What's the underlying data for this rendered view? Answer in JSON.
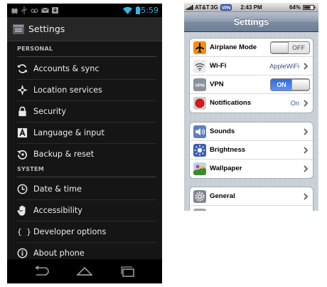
{
  "android": {
    "status_bar": {
      "clock": "05:59",
      "icons": [
        "usb-debug-icon",
        "usb-icon",
        "voicemail-icon",
        "email-icon",
        "download-icon",
        "wifi-icon",
        "battery-icon"
      ]
    },
    "action_bar": {
      "title": "Settings",
      "icon": "settings-app-icon"
    },
    "sections": [
      {
        "header": "PERSONAL",
        "items": [
          {
            "label": "Accounts & sync",
            "icon": "sync-icon"
          },
          {
            "label": "Location services",
            "icon": "location-icon"
          },
          {
            "label": "Security",
            "icon": "lock-icon"
          },
          {
            "label": "Language & input",
            "icon": "keyboard-a-icon"
          },
          {
            "label": "Backup & reset",
            "icon": "backup-icon"
          }
        ]
      },
      {
        "header": "SYSTEM",
        "items": [
          {
            "label": "Date & time",
            "icon": "clock-icon"
          },
          {
            "label": "Accessibility",
            "icon": "hand-icon"
          },
          {
            "label": "Developer options",
            "icon": "braces-icon",
            "glyph": "{ }"
          },
          {
            "label": "About phone",
            "icon": "info-icon"
          }
        ]
      }
    ],
    "nav_bar": [
      "back-icon",
      "home-icon",
      "recent-apps-icon"
    ],
    "colors": {
      "background": "#151515",
      "accent": "#33b5e5"
    }
  },
  "iphone": {
    "status_bar": {
      "carrier": "AT&T",
      "network": "3G",
      "time": "2:43 PM",
      "battery": "64%"
    },
    "nav_bar": {
      "title": "Settings"
    },
    "groups": [
      [
        {
          "label": "Airplane Mode",
          "icon": "airplane-icon",
          "type": "switch",
          "value": "OFF",
          "on": false
        },
        {
          "label": "Wi-Fi",
          "icon": "wifi-icon",
          "type": "detail",
          "value": "AppleWiFi"
        },
        {
          "label": "VPN",
          "icon": "vpn-icon",
          "icon_text": "VPN",
          "type": "switch",
          "value": "ON",
          "on": true
        },
        {
          "label": "Notifications",
          "icon": "notifications-icon",
          "type": "detail",
          "value": "On"
        }
      ],
      [
        {
          "label": "Sounds",
          "icon": "speaker-icon",
          "type": "detail",
          "value": ""
        },
        {
          "label": "Brightness",
          "icon": "brightness-icon",
          "type": "detail",
          "value": ""
        },
        {
          "label": "Wallpaper",
          "icon": "wallpaper-icon",
          "type": "detail",
          "value": ""
        }
      ],
      [
        {
          "label": "General",
          "icon": "gear-icon",
          "type": "detail",
          "value": ""
        }
      ]
    ],
    "colors": {
      "nav_bar": "#7c8ca1",
      "value_text": "#385487",
      "switch_on": "#2f6ce0"
    }
  }
}
